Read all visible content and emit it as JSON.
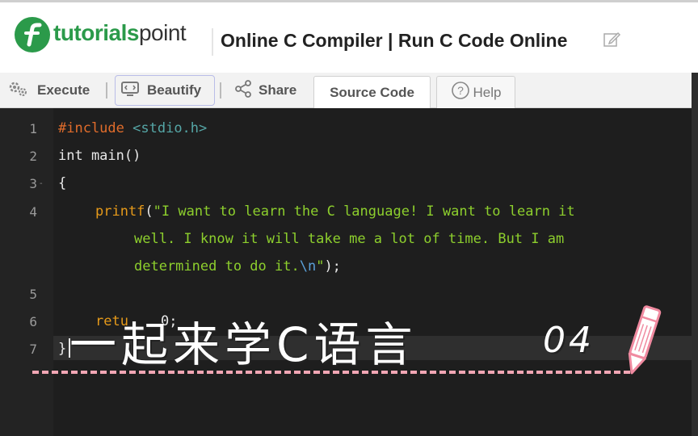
{
  "header": {
    "logo_text_1": "tutorials",
    "logo_text_2": "point",
    "page_title": "Online C Compiler | Run C Code Online"
  },
  "toolbar": {
    "execute_label": "Execute",
    "beautify_label": "Beautify",
    "share_label": "Share",
    "tabs": [
      {
        "label": "Source Code",
        "active": true
      },
      {
        "label": "Help",
        "active": false
      }
    ]
  },
  "editor": {
    "line_numbers": [
      "1",
      "2",
      "3",
      "4",
      "5",
      "6",
      "7"
    ],
    "fold_marker": "-",
    "lines": {
      "l1_directive": "#include",
      "l1_header": "<stdio.h>",
      "l2": "int main()",
      "l3": "{",
      "l4_fn": "printf",
      "l4_open": "(",
      "l4_str_a": "\"I want to learn the C language! I want to learn it",
      "l4_str_b": "well. I know it will take me a lot of time. But I am",
      "l4_str_c": "determined to do it.",
      "l4_esc": "\\n",
      "l4_close_q": "\"",
      "l4_end": ");",
      "l6_visible": "retu",
      "l6_tail": "0;",
      "l7": "}"
    }
  },
  "overlay": {
    "title": "一起来学C语言",
    "number": "04"
  },
  "colors": {
    "brand_green": "#2b9a4a",
    "editor_bg": "#1e1e1e",
    "string_green": "#8dcf2d",
    "function_orange": "#e69a1a",
    "dash_pink": "#f2a6b4"
  }
}
